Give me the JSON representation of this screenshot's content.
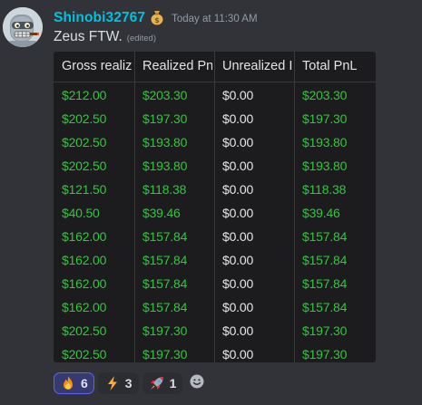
{
  "message": {
    "username": "Shinobi32767",
    "username_color": "#00c1de",
    "badge_icon": "money-bag-icon",
    "timestamp": "Today at 11:30 AM",
    "content": "Zeus FTW.",
    "edited_label": "(edited)",
    "avatar_icon": "robot-avatar"
  },
  "table": {
    "columns": [
      "Gross realized",
      "Realized Pn",
      "Unrealized I",
      "Total PnL"
    ],
    "rows": [
      [
        "$212.00",
        "$203.30",
        "$0.00",
        "$203.30"
      ],
      [
        "$202.50",
        "$197.30",
        "$0.00",
        "$197.30"
      ],
      [
        "$202.50",
        "$193.80",
        "$0.00",
        "$193.80"
      ],
      [
        "$202.50",
        "$193.80",
        "$0.00",
        "$193.80"
      ],
      [
        "$121.50",
        "$118.38",
        "$0.00",
        "$118.38"
      ],
      [
        "$40.50",
        "$39.46",
        "$0.00",
        "$39.46"
      ],
      [
        "$162.00",
        "$157.84",
        "$0.00",
        "$157.84"
      ],
      [
        "$162.00",
        "$157.84",
        "$0.00",
        "$157.84"
      ],
      [
        "$162.00",
        "$157.84",
        "$0.00",
        "$157.84"
      ],
      [
        "$162.00",
        "$157.84",
        "$0.00",
        "$157.84"
      ],
      [
        "$202.50",
        "$197.30",
        "$0.00",
        "$197.30"
      ],
      [
        "$202.50",
        "$197.30",
        "$0.00",
        "$197.30"
      ]
    ],
    "green_color": "#2fc83a",
    "white_color": "#e6e6e6"
  },
  "reactions": [
    {
      "icon": "fire-icon",
      "count": "6",
      "active": true
    },
    {
      "icon": "lightning-icon",
      "count": "3",
      "active": false
    },
    {
      "icon": "rocket-icon",
      "count": "1",
      "active": false
    }
  ],
  "add_reaction_icon": "smiley-add-icon"
}
